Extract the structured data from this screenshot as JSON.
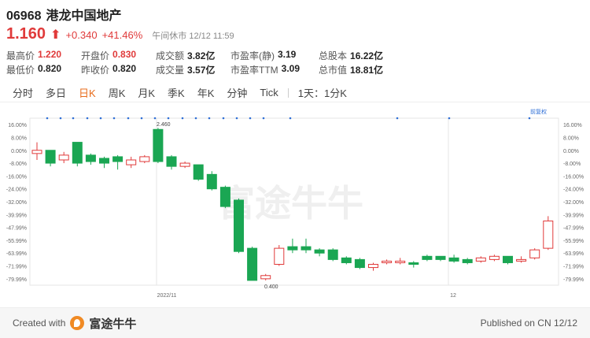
{
  "header": {
    "code": "06968",
    "name": "港龙中国地产",
    "price": "1.160",
    "price_arrow": "⬆",
    "change": "+0.340",
    "change_pct": "+41.46%",
    "status": "午间休市 12/12 11:59"
  },
  "stats": {
    "row1": [
      {
        "label": "最高价",
        "value": "1.220",
        "tone": "up"
      },
      {
        "label": "开盘价",
        "value": "0.830",
        "tone": "up"
      },
      {
        "label": "成交额",
        "value": "3.82亿",
        "tone": "neutral"
      },
      {
        "label": "市盈率(静)",
        "value": "3.19",
        "tone": "neutral"
      },
      {
        "label": "总股本",
        "value": "16.22亿",
        "tone": "neutral"
      }
    ],
    "row2": [
      {
        "label": "最低价",
        "value": "0.820",
        "tone": "neutral"
      },
      {
        "label": "昨收价",
        "value": "0.820",
        "tone": "neutral"
      },
      {
        "label": "成交量",
        "value": "3.57亿",
        "tone": "neutral"
      },
      {
        "label": "市盈率TTM",
        "value": "3.09",
        "tone": "neutral"
      },
      {
        "label": "总市值",
        "value": "18.81亿",
        "tone": "neutral"
      }
    ]
  },
  "tabs": [
    "分时",
    "多日",
    "日K",
    "周K",
    "月K",
    "季K",
    "年K",
    "分钟",
    "Tick"
  ],
  "active_tab": "日K",
  "tabs_extra": "1天：1分K",
  "chart_labels": {
    "adjust": "前复权",
    "high_label": "2.460",
    "low_label": "0.400",
    "x_ticks": [
      "2022/11",
      "12"
    ],
    "watermark": "富途牛牛"
  },
  "footer": {
    "created_with": "Created with",
    "brand": "富途牛牛",
    "published": "Published on CN 12/12"
  },
  "colors": {
    "up": "#e03a3a",
    "down": "#1aa653",
    "accent": "#e86c1c"
  },
  "chart_data": {
    "type": "candlestick",
    "y_axis_left": [
      "16.00%",
      "8.00%",
      "0.00%",
      "-8.00%",
      "-16.00%",
      "-24.00%",
      "-32.00%",
      "-39.99%",
      "-47.99%",
      "-55.99%",
      "-63.99%",
      "-71.99%",
      "-79.99%"
    ],
    "y_axis_right": [
      "16.00%",
      "8.00%",
      "0.00%",
      "-8.00%",
      "-16.00%",
      "-24.00%",
      "-32.00%",
      "-39.99%",
      "-47.99%",
      "-55.99%",
      "-63.99%",
      "-71.99%",
      "-79.99%"
    ],
    "ylim": [
      -84,
      20
    ],
    "candles": [
      {
        "o": -2,
        "c": 0,
        "h": 5,
        "l": -6
      },
      {
        "o": 0,
        "c": -8,
        "h": 0,
        "l": -10
      },
      {
        "o": -6,
        "c": -3,
        "h": -1,
        "l": -8
      },
      {
        "o": 5,
        "c": -8,
        "h": 5,
        "l": -10
      },
      {
        "o": -3,
        "c": -7,
        "h": -2,
        "l": -9
      },
      {
        "o": -5,
        "c": -8,
        "h": -4,
        "l": -11
      },
      {
        "o": -4,
        "c": -7,
        "h": -3,
        "l": -12
      },
      {
        "o": -9,
        "c": -6,
        "h": -4,
        "l": -11
      },
      {
        "o": -7,
        "c": -4,
        "h": -3,
        "l": -8
      },
      {
        "o": 13,
        "c": -7,
        "h": 14,
        "l": -8
      },
      {
        "o": -4,
        "c": -10,
        "h": -3,
        "l": -12
      },
      {
        "o": -10,
        "c": -8,
        "h": -7,
        "l": -11
      },
      {
        "o": -9,
        "c": -18,
        "h": -9,
        "l": -19
      },
      {
        "o": -15,
        "c": -24,
        "h": -13,
        "l": -25
      },
      {
        "o": -23,
        "c": -35,
        "h": -22,
        "l": -36
      },
      {
        "o": -31,
        "c": -63,
        "h": -30,
        "l": -64
      },
      {
        "o": -61,
        "c": -81,
        "h": -60,
        "l": -81
      },
      {
        "o": -80,
        "c": -78,
        "h": -77,
        "l": -81
      },
      {
        "o": -71,
        "c": -61,
        "h": -59,
        "l": -72
      },
      {
        "o": -60,
        "c": -62,
        "h": -55,
        "l": -64
      },
      {
        "o": -60,
        "c": -62,
        "h": -55,
        "l": -64
      },
      {
        "o": -62,
        "c": -64,
        "h": -61,
        "l": -66
      },
      {
        "o": -62,
        "c": -68,
        "h": -61,
        "l": -69
      },
      {
        "o": -67,
        "c": -70,
        "h": -66,
        "l": -71
      },
      {
        "o": -68,
        "c": -73,
        "h": -67,
        "l": -74
      },
      {
        "o": -73,
        "c": -71,
        "h": -70,
        "l": -75
      },
      {
        "o": -70,
        "c": -69,
        "h": -68,
        "l": -71
      },
      {
        "o": -70,
        "c": -69,
        "h": -67,
        "l": -71
      },
      {
        "o": -70,
        "c": -71,
        "h": -69,
        "l": -73
      },
      {
        "o": -66,
        "c": -68,
        "h": -65,
        "l": -69
      },
      {
        "o": -66,
        "c": -68,
        "h": -66,
        "l": -69
      },
      {
        "o": -67,
        "c": -69,
        "h": -65,
        "l": -70
      },
      {
        "o": -68,
        "c": -70,
        "h": -67,
        "l": -71
      },
      {
        "o": -69,
        "c": -67,
        "h": -66,
        "l": -70
      },
      {
        "o": -68,
        "c": -66,
        "h": -65,
        "l": -69
      },
      {
        "o": -66,
        "c": -70,
        "h": -66,
        "l": -71
      },
      {
        "o": -69,
        "c": -68,
        "h": -66,
        "l": -70
      },
      {
        "o": -67,
        "c": -62,
        "h": -61,
        "l": -68
      },
      {
        "o": -61,
        "c": -44,
        "h": -41,
        "l": -62
      }
    ]
  }
}
